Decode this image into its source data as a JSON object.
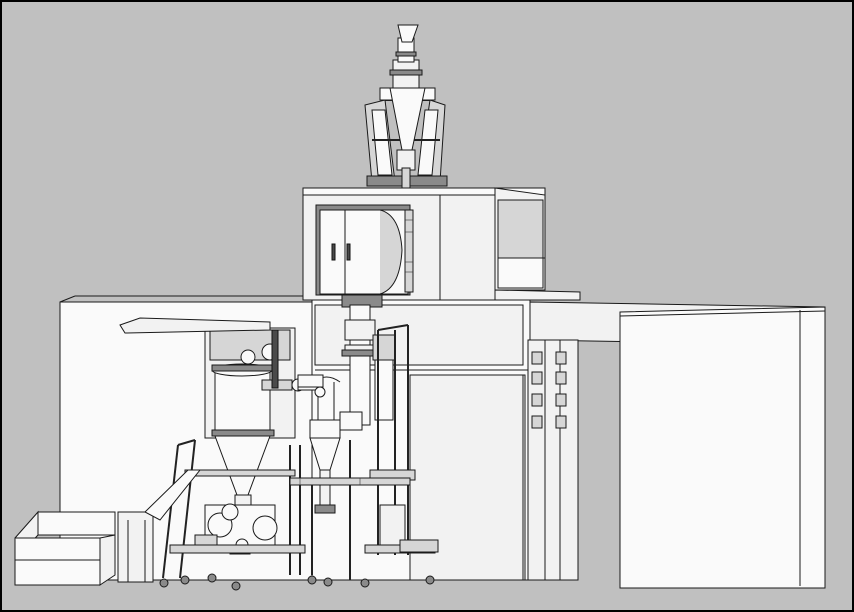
{
  "scene": {
    "kind": "cad-3d-render",
    "colors": {
      "background": "#c0c0c0",
      "border": "#000000",
      "surface_light": "#f2f2f2",
      "surface_white": "#fafafa",
      "surface_grey": "#d6d6d6",
      "surface_dark": "#8a8a8a",
      "outline": "#1a1a1a"
    }
  }
}
